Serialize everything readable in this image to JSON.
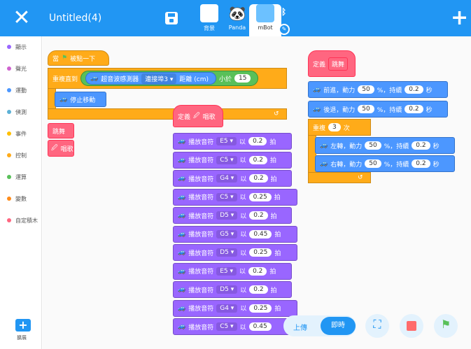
{
  "header": {
    "title": "Untitled(4)"
  },
  "sprites": [
    {
      "label": "背景",
      "icon": "background-thumb-icon"
    },
    {
      "label": "Panda",
      "icon": "panda-thumb-icon"
    },
    {
      "label": "mBot",
      "icon": "mbot-thumb-icon",
      "active": true
    }
  ],
  "categories": [
    {
      "label": "顯示",
      "color": "#9966ff"
    },
    {
      "label": "聲光",
      "color": "#cf63cf"
    },
    {
      "label": "運動",
      "color": "#4c97ff"
    },
    {
      "label": "偵測",
      "color": "#5cb1d6"
    },
    {
      "label": "事件",
      "color": "#ffbf00"
    },
    {
      "label": "控制",
      "color": "#ffab19"
    },
    {
      "label": "運算",
      "color": "#59c059"
    },
    {
      "label": "變數",
      "color": "#ff8c1a"
    },
    {
      "label": "自定積木",
      "color": "#ff6680"
    }
  ],
  "extension_label": "擴展",
  "script_main": {
    "when_flag": "當",
    "when_flag_suffix": "被點一下",
    "repeat_until": "重複直到",
    "sensor": "超音波感測器",
    "port": "連接埠3",
    "distance": "距離 (cm)",
    "less_than": "小於",
    "threshold": "15",
    "stop": "停止移動",
    "call_dance": "跳舞",
    "call_sing": "唱歌"
  },
  "define_sing": {
    "define": "定義",
    "name": "唱歌"
  },
  "notes": [
    {
      "prefix": "播放音符",
      "note": "E5",
      "with": "以",
      "beat": "0.2",
      "suffix": "拍"
    },
    {
      "prefix": "播放音符",
      "note": "C5",
      "with": "以",
      "beat": "0.2",
      "suffix": "拍"
    },
    {
      "prefix": "播放音符",
      "note": "G4",
      "with": "以",
      "beat": "0.2",
      "suffix": "拍"
    },
    {
      "prefix": "播放音符",
      "note": "C5",
      "with": "以",
      "beat": "0.25",
      "suffix": "拍"
    },
    {
      "prefix": "播放音符",
      "note": "D5",
      "with": "以",
      "beat": "0.2",
      "suffix": "拍"
    },
    {
      "prefix": "播放音符",
      "note": "G5",
      "with": "以",
      "beat": "0.45",
      "suffix": "拍"
    },
    {
      "prefix": "播放音符",
      "note": "D5",
      "with": "以",
      "beat": "0.25",
      "suffix": "拍"
    },
    {
      "prefix": "播放音符",
      "note": "E5",
      "with": "以",
      "beat": "0.2",
      "suffix": "拍"
    },
    {
      "prefix": "播放音符",
      "note": "D5",
      "with": "以",
      "beat": "0.2",
      "suffix": "拍"
    },
    {
      "prefix": "播放音符",
      "note": "G4",
      "with": "以",
      "beat": "0.25",
      "suffix": "拍"
    },
    {
      "prefix": "播放音符",
      "note": "C5",
      "with": "以",
      "beat": "0.45",
      "suffix": ""
    }
  ],
  "define_dance": {
    "define": "定義",
    "name": "跳舞",
    "forward": {
      "label": "前進，動力",
      "power": "50",
      "unit": "%，持續",
      "time": "0.2",
      "sec": "秒"
    },
    "backward": {
      "label": "後退，動力",
      "power": "50",
      "unit": "%，持續",
      "time": "0.2",
      "sec": "秒"
    },
    "repeat": "重複",
    "repeat_count": "3",
    "repeat_unit": "次",
    "left": {
      "label": "左轉，動力",
      "power": "50",
      "unit": "%，持續",
      "time": "0.2",
      "sec": "秒"
    },
    "right": {
      "label": "右轉，動力",
      "power": "50",
      "unit": "%，持續",
      "time": "0.2",
      "sec": "秒"
    }
  },
  "controls": {
    "upload": "上傳",
    "live": "即時"
  },
  "colors": {
    "header": "#2196f3",
    "control": "#ffab19",
    "motion": "#4c97ff",
    "sound": "#9966ff",
    "custom": "#ff6680",
    "operator": "#59c059"
  }
}
